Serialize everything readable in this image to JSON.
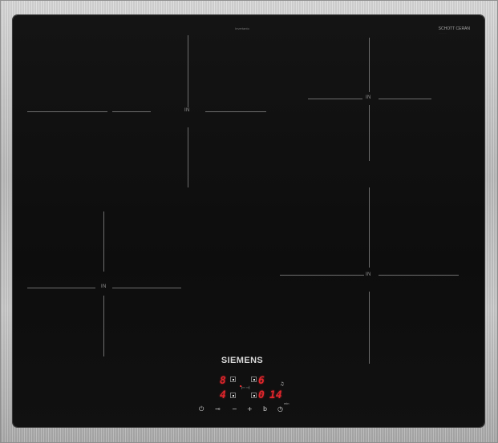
{
  "brand": {
    "name": "SIEMENS",
    "top_text": "Invertanto",
    "glass_brand": "SCHOTT CERAN"
  },
  "zones": [
    {
      "label": "IN"
    },
    {
      "label": "IN"
    },
    {
      "label": "IN"
    },
    {
      "label": "IN"
    }
  ],
  "display": {
    "zone_front_left_level": "8",
    "zone_back_right_level": "6",
    "zone_back_left_level": "4",
    "timer_digits": "0",
    "timer_minutes": "14",
    "timer_unit": "min"
  },
  "controls": [
    {
      "name": "power-button",
      "glyph": "⏻"
    },
    {
      "name": "childlock-button",
      "glyph": "⊸"
    },
    {
      "name": "minus-button",
      "glyph": "−"
    },
    {
      "name": "plus-button",
      "glyph": "+"
    },
    {
      "name": "boost-button",
      "glyph": "b"
    },
    {
      "name": "timer-button",
      "glyph": "◷"
    }
  ],
  "colors": {
    "glass": "#0f0f0f",
    "frame": "#c0c0c0",
    "display_red": "#e1262c"
  }
}
